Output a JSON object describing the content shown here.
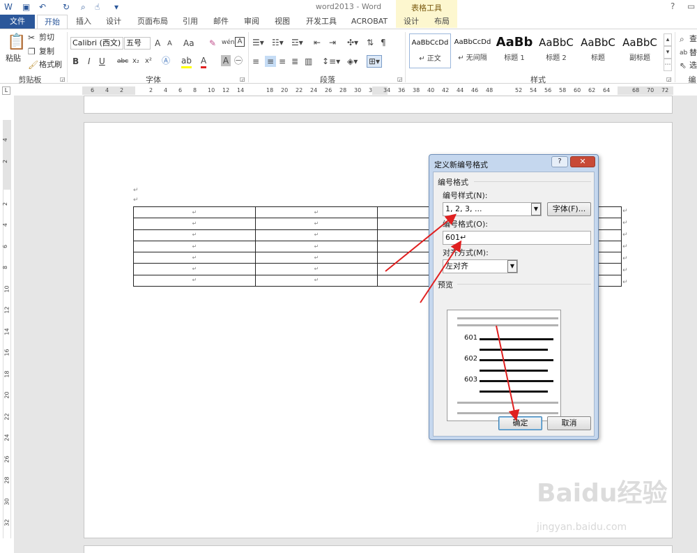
{
  "window": {
    "title": "word2013 - Word",
    "context_group": "表格工具",
    "help": "?"
  },
  "tabs": {
    "file": "文件",
    "home": "开始",
    "insert": "插入",
    "design": "设计",
    "layout": "页面布局",
    "references": "引用",
    "mailings": "邮件",
    "review": "审阅",
    "view": "视图",
    "developer": "开发工具",
    "acrobat": "ACROBAT",
    "table_design": "设计",
    "table_layout": "布局"
  },
  "ribbon": {
    "clipboard": {
      "paste": "粘贴",
      "cut": "剪切",
      "copy": "复制",
      "format_painter": "格式刷",
      "label": "剪贴板"
    },
    "font": {
      "font_name": "Calibri (西文)",
      "font_size": "五号",
      "label": "字体",
      "bold": "B",
      "italic": "I",
      "underline": "U",
      "strike": "abc",
      "sub": "x₂",
      "sup": "x²",
      "case": "Aa",
      "grow": "A",
      "shrink": "A",
      "phonetic": "wén"
    },
    "paragraph": {
      "label": "段落"
    },
    "styles": {
      "label": "样式",
      "items": [
        {
          "sample": "AaBbCcDd",
          "name": "↵ 正文"
        },
        {
          "sample": "AaBbCcDd",
          "name": "↵ 无间隔"
        },
        {
          "sample": "AaBb",
          "name": "标题 1"
        },
        {
          "sample": "AaBbC",
          "name": "标题 2"
        },
        {
          "sample": "AaBbC",
          "name": "标题"
        },
        {
          "sample": "AaBbC",
          "name": "副标题"
        }
      ]
    },
    "editing": {
      "find": "查",
      "replace": "替",
      "select": "选",
      "label": "编"
    }
  },
  "ruler": {
    "corner": "L",
    "h_ticks": [
      "6",
      "4",
      "2",
      "",
      "2",
      "4",
      "6",
      "8",
      "10",
      "12",
      "14",
      "",
      "18",
      "20",
      "22",
      "24",
      "26",
      "28",
      "30",
      "3",
      "34",
      "36",
      "38",
      "40",
      "42",
      "44",
      "46",
      "48",
      "",
      "52",
      "54",
      "56",
      "58",
      "60",
      "62",
      "64",
      "",
      "68",
      "70",
      "72"
    ],
    "v_ticks": [
      "4",
      "2",
      "",
      "2",
      "4",
      "6",
      "8",
      "10",
      "12",
      "14",
      "16",
      "18",
      "20",
      "22",
      "24",
      "26",
      "28",
      "30",
      "32"
    ]
  },
  "document": {
    "para_mark": "↵",
    "table": {
      "rows": 7,
      "cells": [
        [
          "↵",
          "↵",
          "",
          ""
        ],
        [
          "↵",
          "↵",
          "",
          ""
        ],
        [
          "↵",
          "↵",
          "",
          ""
        ],
        [
          "↵",
          "↵",
          "",
          ""
        ],
        [
          "↵",
          "↵",
          "",
          ""
        ],
        [
          "↵",
          "↵",
          "",
          ""
        ],
        [
          "↵",
          "↵",
          "",
          ""
        ]
      ]
    }
  },
  "dialog": {
    "title": "定义新编号格式",
    "help_btn": "?",
    "close_btn": "✕",
    "section_number_format": "编号格式",
    "number_style_label": "编号样式(N):",
    "number_style_value": "1, 2, 3, ...",
    "font_button": "字体(F)...",
    "number_format_label": "编号格式(O):",
    "number_format_value": "601↵",
    "alignment_label": "对齐方式(M):",
    "alignment_value": "左对齐",
    "preview_label": "预览",
    "preview_numbers": [
      "601",
      "602",
      "603"
    ],
    "ok": "确定",
    "cancel": "取消"
  },
  "watermark": {
    "text": "Baidu经验",
    "sub": "jingyan.baidu.com"
  },
  "colors": {
    "accent": "#2b579a",
    "context_tab_bg": "#fdf7cf",
    "annotation_arrow": "#e02020",
    "dialog_frame": "#c5d7ee"
  }
}
